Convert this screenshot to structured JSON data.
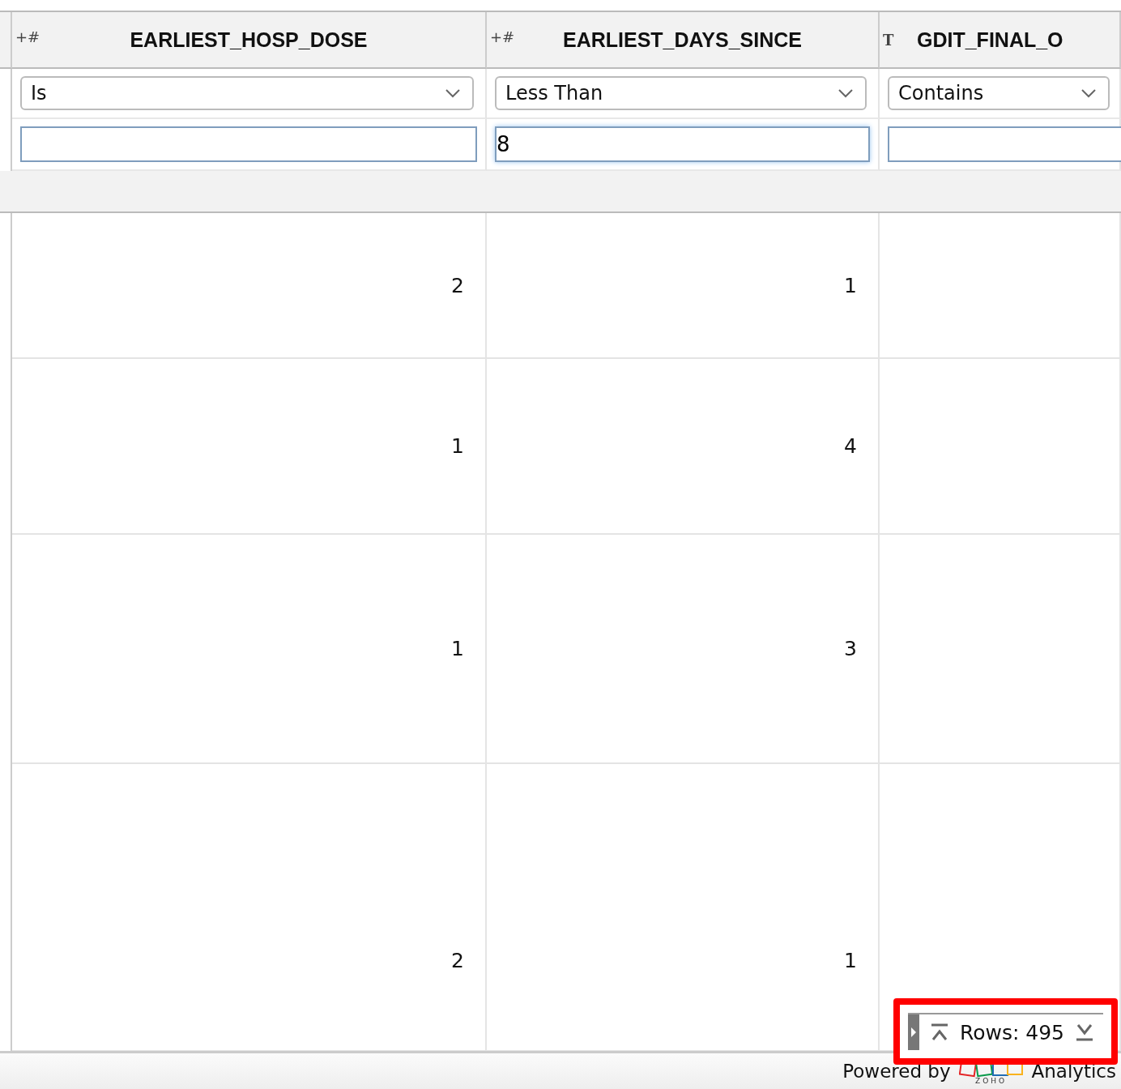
{
  "columns": [
    {
      "kind": "number",
      "type_icon": "+#",
      "title": "EARLIEST_HOSP_DOSE",
      "operator": "Is",
      "focused": false
    },
    {
      "kind": "number",
      "type_icon": "+#",
      "title": "EARLIEST_DAYS_SINCE",
      "operator": "Less Than",
      "filter_value": "8",
      "focused": true
    },
    {
      "kind": "text",
      "type_icon": "T",
      "title": "GDIT_FINAL_O",
      "operator": "Contains",
      "focused": false
    }
  ],
  "rows": [
    [
      "2",
      "1",
      ""
    ],
    [
      "1",
      "4",
      ""
    ],
    [
      "1",
      "3",
      ""
    ],
    [
      "2",
      "1",
      ""
    ]
  ],
  "rows_indicator": {
    "label": "Rows: 495",
    "highlighted": true
  },
  "footer": {
    "powered_by": "Powered by",
    "logo_text": "ZOHO",
    "product": "Analytics"
  }
}
